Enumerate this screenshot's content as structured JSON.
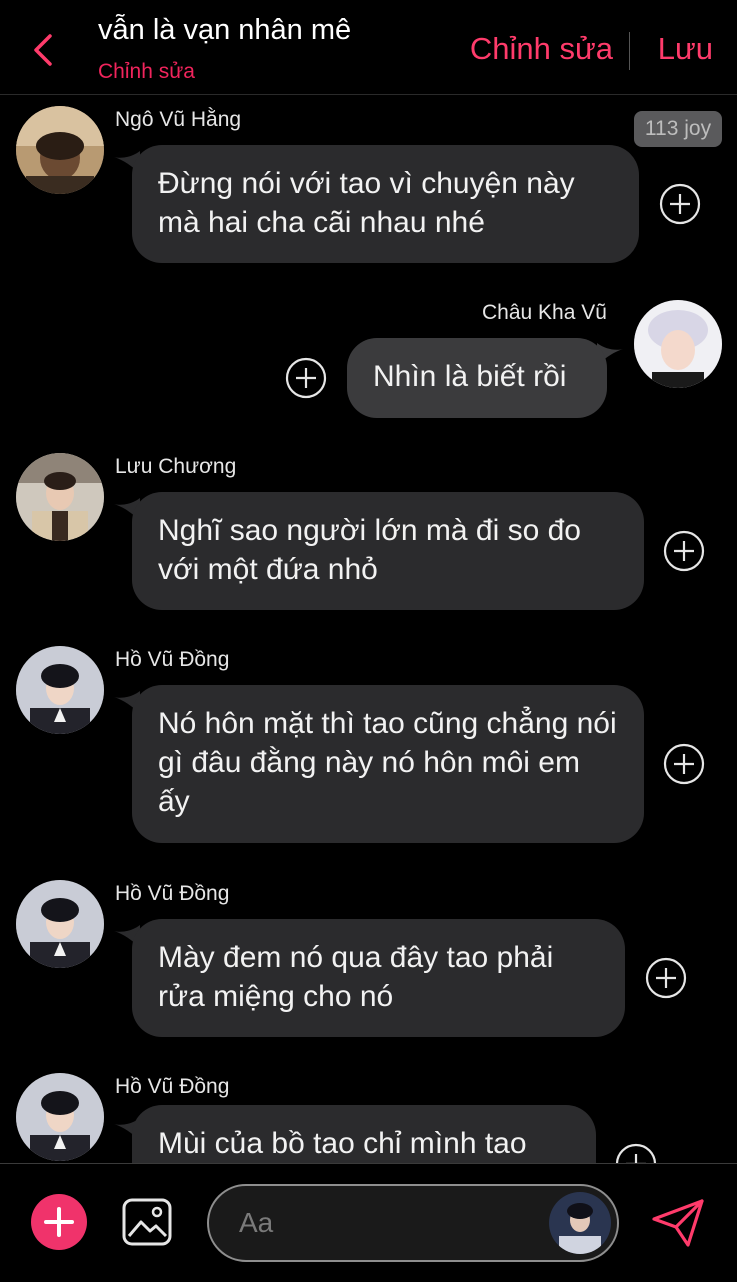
{
  "header": {
    "title": "vẫn là vạn nhân mê",
    "subtitle": "Chỉnh sửa",
    "edit_label": "Chỉnh sửa",
    "save_label": "Lưu"
  },
  "badge": "113 joy",
  "messages": [
    {
      "sender": "Ngô Vũ Hằng",
      "side": "left",
      "text": "Đừng nói với tao vì chuyện này mà hai cha cãi nhau nhé"
    },
    {
      "sender": "Châu Kha Vũ",
      "side": "right",
      "text": "Nhìn là biết rồi"
    },
    {
      "sender": "Lưu Chương",
      "side": "left",
      "text": "Nghĩ sao người lớn mà đi so đo với một đứa nhỏ"
    },
    {
      "sender": "Hồ Vũ Đồng",
      "side": "left",
      "text": "Nó hôn mặt thì tao cũng chẳng nói gì đâu đằng này nó hôn môi em ấy"
    },
    {
      "sender": "Hồ Vũ Đồng",
      "side": "left",
      "text": "Mày đem nó qua đây tao phải rửa miệng cho nó"
    },
    {
      "sender": "Hồ Vũ Đồng",
      "side": "left",
      "text": "Mùi của bồ tao chỉ mình tao"
    }
  ],
  "composer": {
    "placeholder": "Aa"
  },
  "colors": {
    "accent": "#ff3b6b",
    "bubble": "#2b2b2d",
    "background": "#000000"
  },
  "icons": [
    "back-chevron-icon",
    "plus-circle-icon",
    "add-icon",
    "image-icon",
    "send-icon"
  ]
}
